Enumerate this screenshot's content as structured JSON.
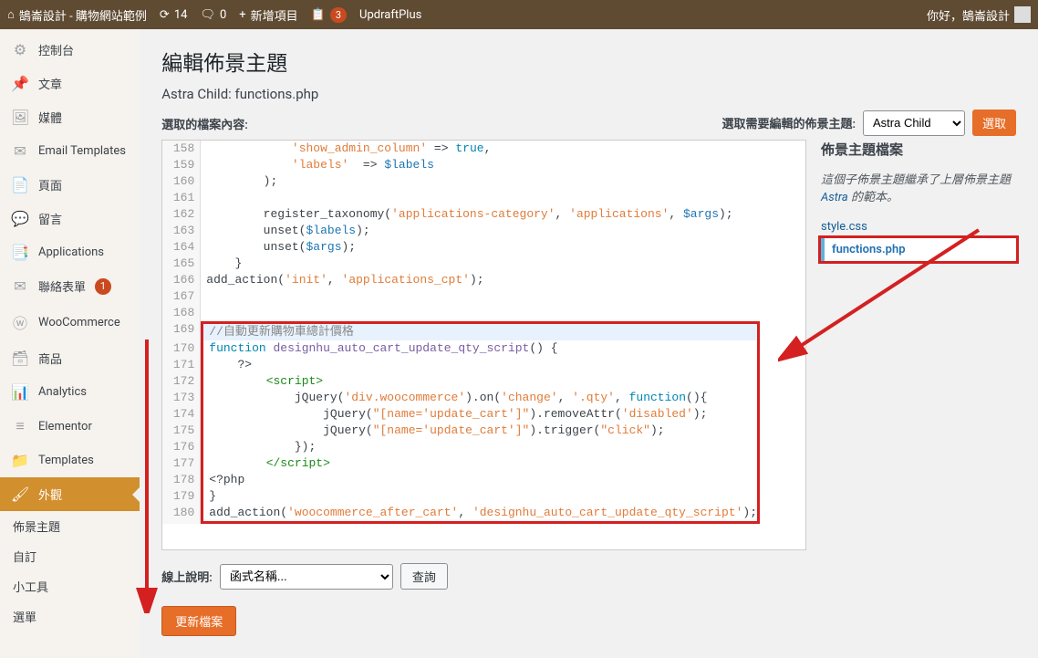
{
  "topbar": {
    "site_name": "鵠崙設計 - 購物網站範例",
    "updates_count": "14",
    "comments_count": "0",
    "new_label": "新增項目",
    "wpforms_count": "3",
    "updraft_label": "UpdraftPlus",
    "greeting": "你好，鵠崙設計"
  },
  "sidebar": {
    "items": [
      {
        "icon": "⚙",
        "label": "控制台"
      },
      {
        "icon": "📌",
        "label": "文章"
      },
      {
        "icon": "🖼",
        "label": "媒體"
      },
      {
        "icon": "✉",
        "label": "Email Templates"
      },
      {
        "icon": "📄",
        "label": "頁面"
      },
      {
        "icon": "💬",
        "label": "留言"
      },
      {
        "icon": "📑",
        "label": "Applications"
      },
      {
        "icon": "✉",
        "label": "聯絡表單",
        "badge": "1"
      },
      {
        "icon": "ⓦ",
        "label": "WooCommerce"
      },
      {
        "icon": "🗃",
        "label": "商品"
      },
      {
        "icon": "📊",
        "label": "Analytics"
      },
      {
        "icon": "≡",
        "label": "Elementor"
      },
      {
        "icon": "📁",
        "label": "Templates"
      },
      {
        "icon": "🖌",
        "label": "外觀",
        "current": true
      }
    ],
    "submenu": [
      "佈景主題",
      "自訂",
      "小工具",
      "選單"
    ]
  },
  "page": {
    "title": "編輯佈景主題",
    "subtitle": "Astra Child: functions.php",
    "select_theme_label": "選取需要編輯的佈景主題:",
    "select_theme_value": "Astra Child",
    "select_btn": "選取",
    "file_content_label": "選取的檔案內容:"
  },
  "code": [
    {
      "n": "158",
      "tokens": [
        [
          "            ",
          ""
        ],
        [
          "'show_admin_column'",
          "str"
        ],
        [
          " => ",
          ""
        ],
        [
          "true",
          "kw"
        ],
        [
          ",",
          ""
        ]
      ]
    },
    {
      "n": "159",
      "tokens": [
        [
          "            ",
          ""
        ],
        [
          "'labels'",
          "str"
        ],
        [
          "  => ",
          ""
        ],
        [
          "$labels",
          "var"
        ]
      ]
    },
    {
      "n": "160",
      "tokens": [
        [
          "        );",
          ""
        ]
      ]
    },
    {
      "n": "161",
      "tokens": [
        [
          "",
          ""
        ]
      ]
    },
    {
      "n": "162",
      "tokens": [
        [
          "        register_taxonomy(",
          ""
        ],
        [
          "'applications-category'",
          "str"
        ],
        [
          ", ",
          ""
        ],
        [
          "'applications'",
          "str"
        ],
        [
          ", ",
          ""
        ],
        [
          "$args",
          "var"
        ],
        [
          ");",
          ""
        ]
      ]
    },
    {
      "n": "163",
      "tokens": [
        [
          "        unset(",
          ""
        ],
        [
          "$labels",
          "var"
        ],
        [
          ");",
          ""
        ]
      ]
    },
    {
      "n": "164",
      "tokens": [
        [
          "        unset(",
          ""
        ],
        [
          "$args",
          "var"
        ],
        [
          ");",
          ""
        ]
      ]
    },
    {
      "n": "165",
      "tokens": [
        [
          "    }",
          ""
        ]
      ]
    },
    {
      "n": "166",
      "tokens": [
        [
          "add_action(",
          ""
        ],
        [
          "'init'",
          "str"
        ],
        [
          ", ",
          ""
        ],
        [
          "'applications_cpt'",
          "str"
        ],
        [
          ");",
          ""
        ]
      ]
    },
    {
      "n": "167",
      "tokens": [
        [
          "",
          ""
        ]
      ]
    },
    {
      "n": "168",
      "tokens": [
        [
          "",
          ""
        ]
      ]
    },
    {
      "n": "169",
      "active": true,
      "tokens": [
        [
          "//自動更新購物車總計價格",
          "cm"
        ]
      ]
    },
    {
      "n": "170",
      "tokens": [
        [
          "function ",
          "kw"
        ],
        [
          "designhu_auto_cart_update_qty_script",
          "fn"
        ],
        [
          "() {",
          ""
        ]
      ]
    },
    {
      "n": "171",
      "tokens": [
        [
          "    ?>",
          ""
        ]
      ]
    },
    {
      "n": "172",
      "tokens": [
        [
          "        ",
          ""
        ],
        [
          "<script>",
          "tag"
        ]
      ]
    },
    {
      "n": "173",
      "tokens": [
        [
          "            jQuery(",
          ""
        ],
        [
          "'div.woocommerce'",
          "str"
        ],
        [
          ").on(",
          ""
        ],
        [
          "'change'",
          "str"
        ],
        [
          ", ",
          ""
        ],
        [
          "'.qty'",
          "str"
        ],
        [
          ", ",
          ""
        ],
        [
          "function",
          "kw"
        ],
        [
          "(){",
          ""
        ]
      ]
    },
    {
      "n": "174",
      "tokens": [
        [
          "                jQuery(",
          ""
        ],
        [
          "\"[name='update_cart']\"",
          "str"
        ],
        [
          ").removeAttr(",
          ""
        ],
        [
          "'disabled'",
          "str"
        ],
        [
          ");",
          ""
        ]
      ]
    },
    {
      "n": "175",
      "tokens": [
        [
          "                jQuery(",
          ""
        ],
        [
          "\"[name='update_cart']\"",
          "str"
        ],
        [
          ").trigger(",
          ""
        ],
        [
          "\"click\"",
          "str"
        ],
        [
          ");",
          ""
        ]
      ]
    },
    {
      "n": "176",
      "tokens": [
        [
          "            });",
          ""
        ]
      ]
    },
    {
      "n": "177",
      "tokens": [
        [
          "        ",
          ""
        ],
        [
          "</script>",
          "tag"
        ]
      ]
    },
    {
      "n": "178",
      "tokens": [
        [
          "<?php",
          ""
        ]
      ]
    },
    {
      "n": "179",
      "tokens": [
        [
          "}",
          ""
        ]
      ]
    },
    {
      "n": "180",
      "tokens": [
        [
          "add_action(",
          ""
        ],
        [
          "'woocommerce_after_cart'",
          "str"
        ],
        [
          ", ",
          ""
        ],
        [
          "'designhu_auto_cart_update_qty_script'",
          "str"
        ],
        [
          ");",
          ""
        ]
      ]
    }
  ],
  "files": {
    "heading": "佈景主題檔案",
    "desc_pre": "這個子佈景主題繼承了上層佈景主題 ",
    "desc_link": "Astra",
    "desc_post": " 的範本。",
    "list": [
      {
        "name": "style.css"
      },
      {
        "name": "functions.php",
        "active": true
      }
    ]
  },
  "doc": {
    "label": "線上說明:",
    "placeholder": "函式名稱...",
    "lookup_btn": "查詢"
  },
  "update_btn": "更新檔案"
}
